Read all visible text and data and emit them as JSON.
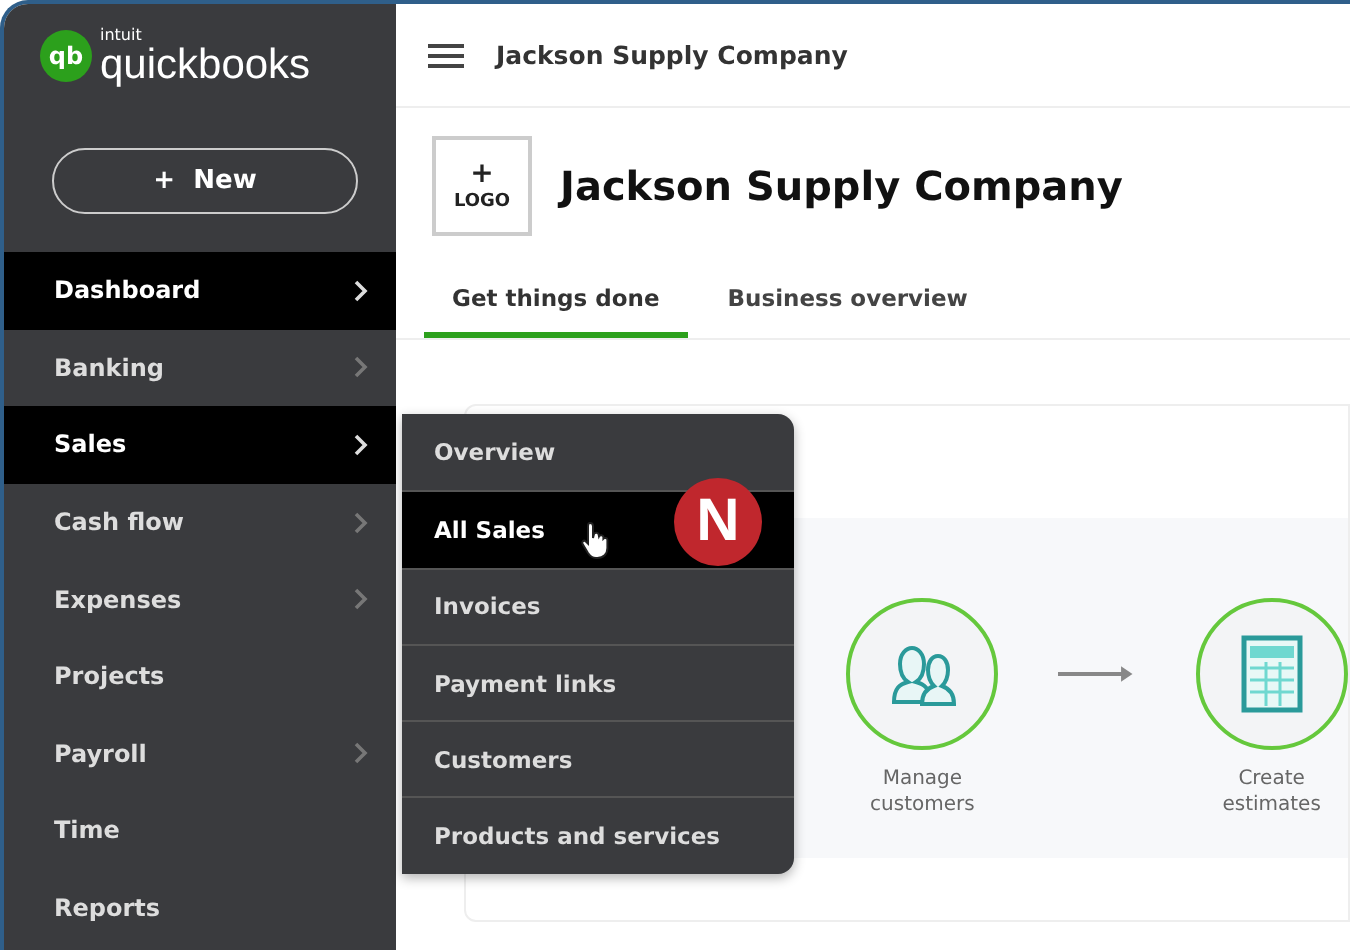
{
  "brand": {
    "small": "intuit",
    "name": "quickbooks",
    "mark": "qb"
  },
  "new_button": {
    "label": "+  New"
  },
  "sidebar": {
    "items": [
      {
        "label": "Dashboard",
        "selected": true,
        "has_submenu": true
      },
      {
        "label": "Banking",
        "selected": false,
        "has_submenu": true
      },
      {
        "label": "Sales",
        "selected": true,
        "has_submenu": true
      },
      {
        "label": "Cash flow",
        "selected": false,
        "has_submenu": true
      },
      {
        "label": "Expenses",
        "selected": false,
        "has_submenu": true
      },
      {
        "label": "Projects",
        "selected": false,
        "has_submenu": false
      },
      {
        "label": "Payroll",
        "selected": false,
        "has_submenu": true
      },
      {
        "label": "Time",
        "selected": false,
        "has_submenu": false
      },
      {
        "label": "Reports",
        "selected": false,
        "has_submenu": false
      }
    ]
  },
  "header": {
    "company": "Jackson Supply Company"
  },
  "logo_box": {
    "plus": "+",
    "label": "LOGO"
  },
  "title": "Jackson Supply Company",
  "tabs": [
    {
      "label": "Get things done",
      "selected": true
    },
    {
      "label": "Business overview",
      "selected": false
    }
  ],
  "submenu": {
    "items": [
      {
        "label": "Overview",
        "selected": false
      },
      {
        "label": "All Sales",
        "selected": true
      },
      {
        "label": "Invoices",
        "selected": false
      },
      {
        "label": "Payment links",
        "selected": false
      },
      {
        "label": "Customers",
        "selected": false
      },
      {
        "label": "Products and services",
        "selected": false
      }
    ]
  },
  "badge": {
    "letter": "N"
  },
  "workflow": [
    {
      "kind": "customers",
      "label": "Manage customers"
    },
    {
      "kind": "estimates",
      "label": "Create estimates"
    }
  ]
}
